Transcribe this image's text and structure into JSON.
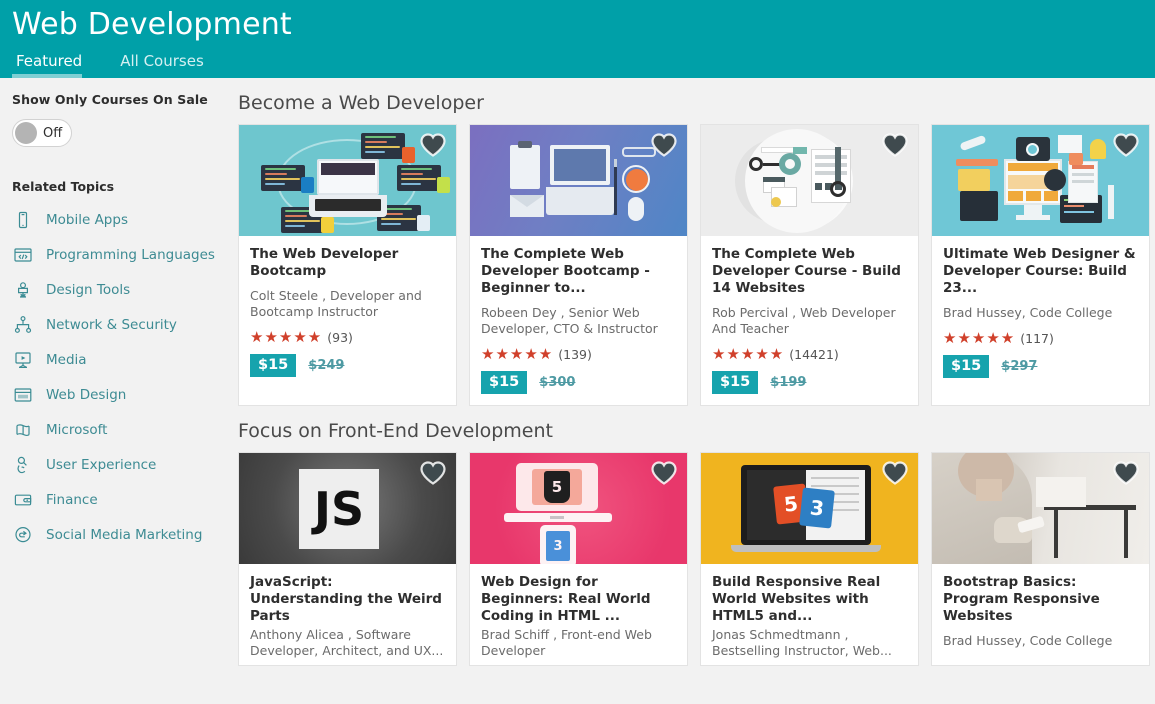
{
  "header": {
    "title": "Web Development",
    "tabs": [
      {
        "label": "Featured",
        "active": true
      },
      {
        "label": "All Courses",
        "active": false
      }
    ]
  },
  "sidebar": {
    "filter_label": "Show Only Courses On Sale",
    "toggle_state": "Off",
    "related_title": "Related Topics",
    "topics": [
      {
        "label": "Mobile Apps",
        "icon": "mobile-phone-icon"
      },
      {
        "label": "Programming Languages",
        "icon": "code-window-icon"
      },
      {
        "label": "Design Tools",
        "icon": "design-tool-icon"
      },
      {
        "label": "Network & Security",
        "icon": "network-nodes-icon"
      },
      {
        "label": "Media",
        "icon": "media-projector-icon"
      },
      {
        "label": "Web Design",
        "icon": "browser-window-icon"
      },
      {
        "label": "Microsoft",
        "icon": "microsoft-windows-icon"
      },
      {
        "label": "User Experience",
        "icon": "user-experience-icon"
      },
      {
        "label": "Finance",
        "icon": "wallet-icon"
      },
      {
        "label": "Social Media Marketing",
        "icon": "share-circle-icon"
      }
    ]
  },
  "colors": {
    "header_teal": "#00a0a8",
    "accent_teal": "#16a3ad",
    "link_teal": "#3d8b93",
    "star_red": "#d0402b",
    "page_bg": "#f2f2f2"
  },
  "sections": [
    {
      "title": "Become a Web Developer",
      "courses": [
        {
          "title": "The Web Developer Bootcamp",
          "author": "Colt Steele , Developer and Bootcamp Instructor",
          "stars": "★★★★★",
          "rating_count": "(93)",
          "price_new": "$15",
          "price_old": "$249",
          "thumb_style": "teal-laptop",
          "favorited": true
        },
        {
          "title": "The Complete Web Developer Bootcamp - Beginner to...",
          "author": "Robeen Dey , Senior Web Developer, CTO & Instructor",
          "stars": "★★★★★",
          "rating_count": "(139)",
          "price_new": "$15",
          "price_old": "$300",
          "thumb_style": "purple-desk",
          "favorited": true
        },
        {
          "title": "The Complete Web Developer Course - Build 14 Websites",
          "author": "Rob Percival , Web Developer And Teacher",
          "stars": "★★★★★",
          "rating_count": "(14421)",
          "price_new": "$15",
          "price_old": "$199",
          "thumb_style": "gray-gears",
          "favorited": true
        },
        {
          "title": "Ultimate Web Designer & Developer Course: Build 23...",
          "author": "Brad Hussey, Code College",
          "stars": "★★★★★",
          "rating_count": "(117)",
          "price_new": "$15",
          "price_old": "$297",
          "thumb_style": "cyan-workspace",
          "favorited": true
        }
      ]
    },
    {
      "title": "Focus on Front-End Development",
      "courses": [
        {
          "title": "JavaScript: Understanding the Weird Parts",
          "author": "Anthony Alicea , Software Developer, Architect, and UX...",
          "stars": "",
          "rating_count": "",
          "price_new": "",
          "price_old": "",
          "thumb_style": "gray-js",
          "favorited": true
        },
        {
          "title": "Web Design for Beginners: Real World Coding in HTML ...",
          "author": "Brad Schiff , Front-end Web Developer",
          "stars": "",
          "rating_count": "",
          "price_new": "",
          "price_old": "",
          "thumb_style": "pink-html",
          "favorited": true
        },
        {
          "title": "Build Responsive Real World Websites with HTML5 and...",
          "author": "Jonas Schmedtmann , Bestselling Instructor, Web...",
          "stars": "",
          "rating_count": "",
          "price_new": "",
          "price_old": "",
          "thumb_style": "yellow-laptop",
          "favorited": true
        },
        {
          "title": "Bootstrap Basics: Program Responsive Websites",
          "author": "Brad Hussey, Code College",
          "stars": "",
          "rating_count": "",
          "price_new": "",
          "price_old": "",
          "thumb_style": "photo-phone",
          "favorited": true
        }
      ]
    }
  ]
}
